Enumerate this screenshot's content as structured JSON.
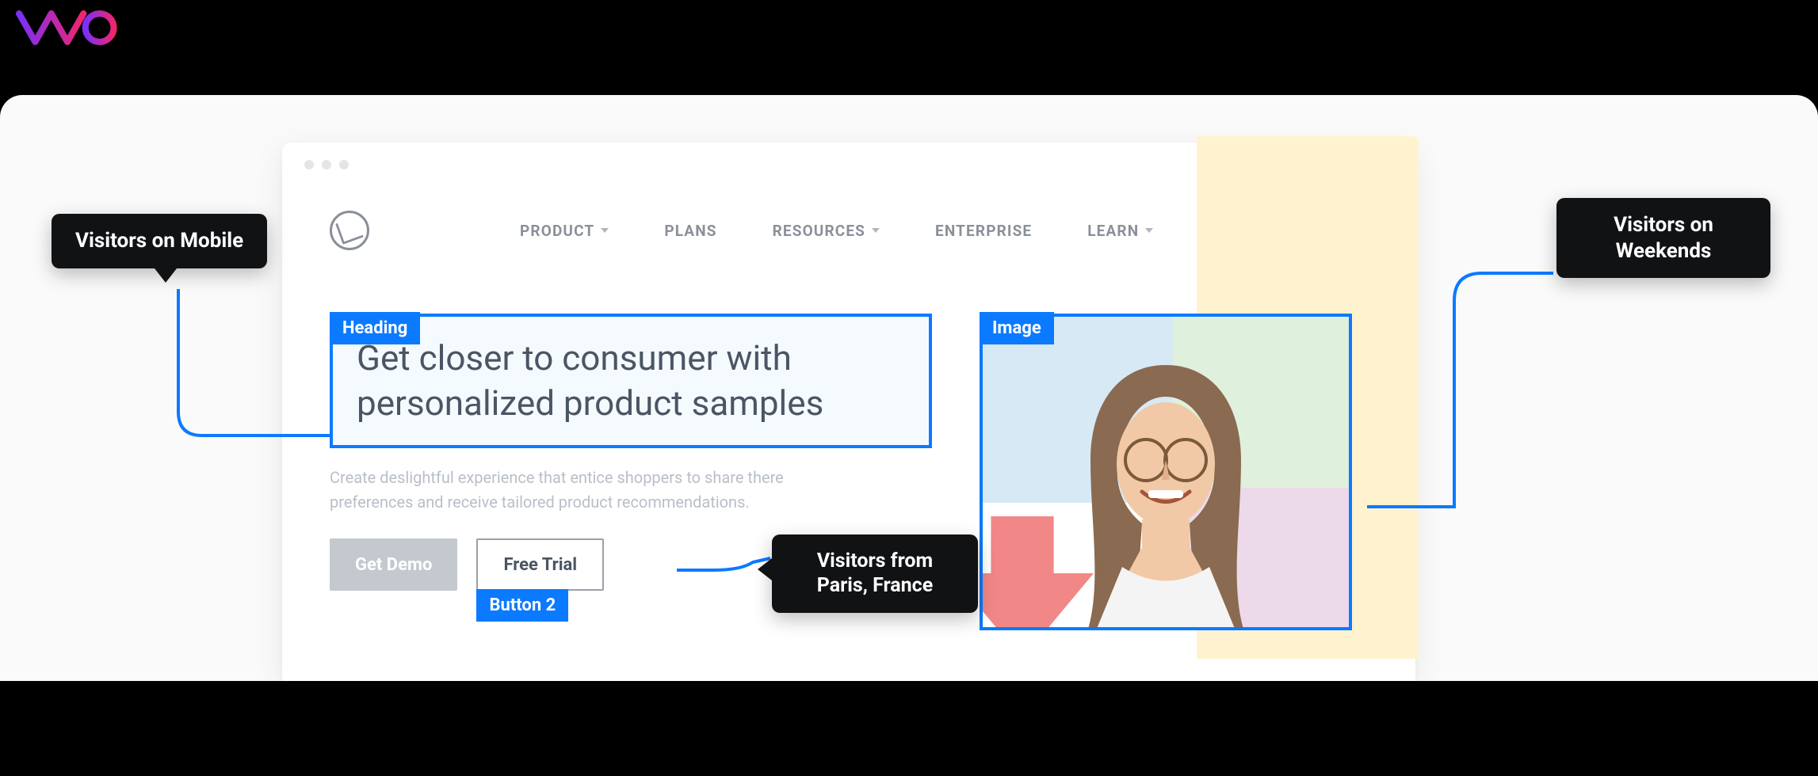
{
  "logo_alt": "VWO",
  "nav": {
    "items": [
      {
        "label": "PRODUCT",
        "has_chevron": true
      },
      {
        "label": "PLANS",
        "has_chevron": false
      },
      {
        "label": "RESOURCES",
        "has_chevron": true
      },
      {
        "label": "ENTERPRISE",
        "has_chevron": false
      },
      {
        "label": "LEARN",
        "has_chevron": true
      }
    ]
  },
  "editor": {
    "heading_tag": "Heading",
    "image_tag": "Image",
    "button2_tag": "Button 2"
  },
  "hero": {
    "headline": "Get closer to consumer with personalized product samples",
    "subtext": "Create deslightful experience that entice shoppers to share there preferences and receive tailored product recommendations.",
    "primary_cta": "Get Demo",
    "secondary_cta": "Free Trial"
  },
  "callouts": {
    "mobile": "Visitors on Mobile",
    "paris": "Visitors from Paris, France",
    "weekends": "Visitors on Weekends"
  },
  "colors": {
    "accent": "#0b7aff",
    "callout_bg": "#111214"
  }
}
